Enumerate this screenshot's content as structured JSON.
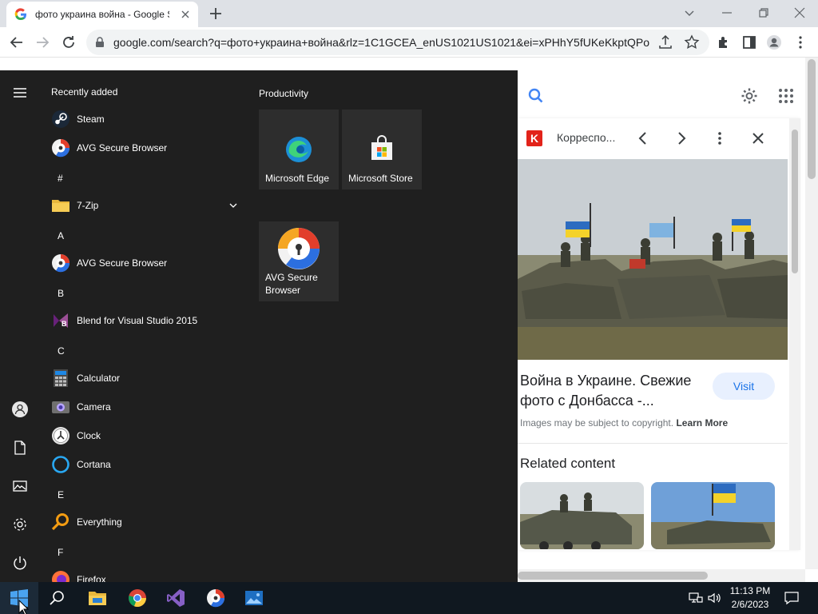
{
  "browser": {
    "tab_title": "фото украина война - Google S",
    "url": "google.com/search?q=фото+украина+война&rlz=1C1GCEA_enUS1021US1021&ei=xPHhY5fUKeKkptQPo..."
  },
  "start_menu": {
    "recently_added_label": "Recently added",
    "apps": [
      {
        "label": "Steam"
      },
      {
        "label": "AVG Secure Browser"
      },
      {
        "letter": "#"
      },
      {
        "label": "7-Zip"
      },
      {
        "letter": "A"
      },
      {
        "label": "AVG Secure Browser"
      },
      {
        "letter": "B"
      },
      {
        "label": "Blend for Visual Studio 2015"
      },
      {
        "letter": "C"
      },
      {
        "label": "Calculator"
      },
      {
        "label": "Camera"
      },
      {
        "label": "Clock"
      },
      {
        "label": "Cortana"
      },
      {
        "letter": "E"
      },
      {
        "label": "Everything"
      },
      {
        "letter": "F"
      },
      {
        "label": "Firefox"
      }
    ],
    "group_title": "Productivity",
    "tiles": [
      {
        "label": "Microsoft Edge"
      },
      {
        "label": "Microsoft Store"
      },
      {
        "label": "AVG Secure Browser"
      }
    ]
  },
  "google_panel": {
    "source_badge": "K",
    "source_name": "Корреспо...",
    "title": "Война в Украине. Свежие фото с Донбасса -...",
    "visit_label": "Visit",
    "copyright_text": "Images may be subject to copyright.",
    "learn_more": "Learn More",
    "related_label": "Related content"
  },
  "taskbar": {
    "time": "11:13 PM",
    "date": "2/6/2023"
  },
  "colors": {
    "start_bg": "#1f1f1f",
    "taskbar_bg": "#101820",
    "accent_blue": "#1a73e8",
    "badge_red": "#e2231a"
  }
}
